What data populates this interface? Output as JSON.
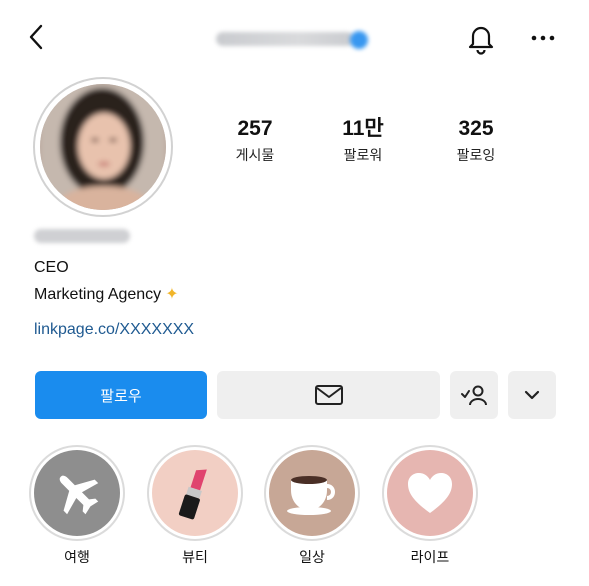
{
  "header": {
    "back_icon": "chevron-left-icon",
    "bell_icon": "bell-icon",
    "more_icon": "more-horizontal-icon"
  },
  "profile": {
    "stats": [
      {
        "count": "257",
        "label": "게시물"
      },
      {
        "count": "11만",
        "label": "팔로워"
      },
      {
        "count": "325",
        "label": "팔로잉"
      }
    ],
    "bio": {
      "line1": "CEO",
      "line2": "Marketing Agency",
      "sparkle": "✦",
      "link": "linkpage.co/XXXXXXX"
    }
  },
  "actions": {
    "follow_label": "팔로우",
    "message_icon": "envelope-icon",
    "suggest_icon": "person-suggest-icon",
    "more_icon": "chevron-down-icon",
    "accent_color": "#1a8cee"
  },
  "highlights": [
    {
      "label": "여행",
      "icon": "airplane-icon",
      "bg": "#8e8e8e"
    },
    {
      "label": "뷰티",
      "icon": "lipstick-icon",
      "bg": "#f2cfc4"
    },
    {
      "label": "일상",
      "icon": "coffee-cup-icon",
      "bg": "#c7a796"
    },
    {
      "label": "라이프",
      "icon": "heart-icon",
      "bg": "#e6b6b1"
    }
  ]
}
